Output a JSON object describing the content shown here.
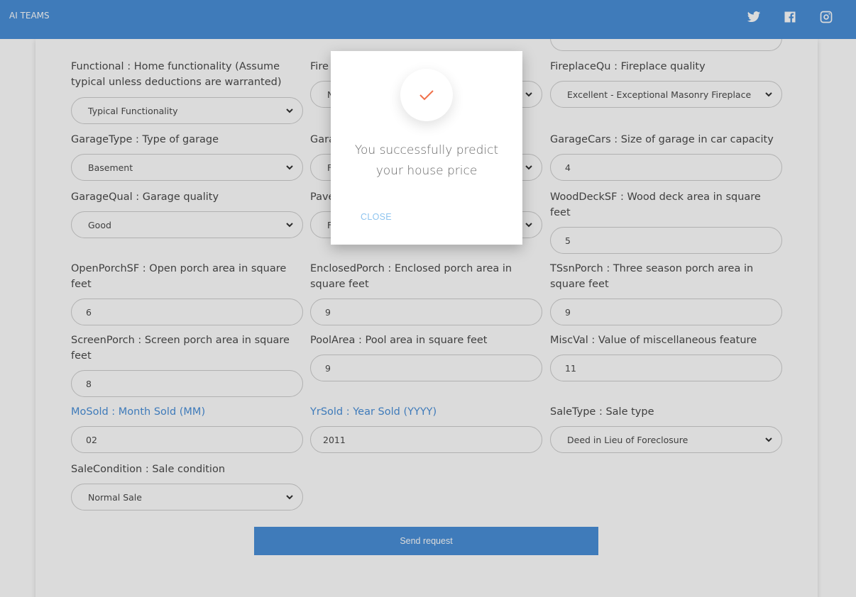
{
  "navbar": {
    "brand": "AI TEAMS",
    "icons": [
      "twitter-icon",
      "facebook-icon",
      "instagram-icon"
    ],
    "color": "#4a90d9"
  },
  "form": {
    "top_stub": "",
    "functional": {
      "label": "Functional : Home functionality (Assume typical unless deductions are warranted)",
      "value": "Typical Functionality"
    },
    "fireplaces": {
      "label": "Fire",
      "value": "N"
    },
    "fireplacequ": {
      "label": "FireplaceQu : Fireplace quality",
      "value": "Excellent - Exceptional Masonry Fireplace"
    },
    "garagetype": {
      "label": "GarageType : Type of garage",
      "value": "Basement"
    },
    "garagefinish": {
      "label": "Gara",
      "value": "F"
    },
    "garagecars": {
      "label": "GarageCars : Size of garage in car capacity",
      "value": "4"
    },
    "garagequal": {
      "label": "GarageQual : Garage quality",
      "value": "Good"
    },
    "paveddrive": {
      "label": "Pave",
      "value": "F"
    },
    "wooddecksf": {
      "label": "WoodDeckSF : Wood deck area in square feet",
      "value": "5"
    },
    "openporchsf": {
      "label": "OpenPorchSF : Open porch area in square feet",
      "value": "6"
    },
    "enclosedporch": {
      "label": "EnclosedPorch : Enclosed porch area in square feet",
      "value": "9"
    },
    "tssnporch": {
      "label": "TSsnPorch : Three season porch area in square feet",
      "value": "9"
    },
    "screenporch": {
      "label": "ScreenPorch : Screen porch area in square feet",
      "value": "8"
    },
    "poolarea": {
      "label": "PoolArea : Pool area in square feet",
      "value": "9"
    },
    "miscval": {
      "label": "MiscVal : Value of miscellaneous feature",
      "value": "11"
    },
    "mosold": {
      "label": "MoSold : Month Sold (MM)",
      "value": "02"
    },
    "yrsold": {
      "label": "YrSold : Year Sold (YYYY)",
      "value": "2011"
    },
    "saletype": {
      "label": "SaleType : Sale type",
      "value": "Deed in Lieu of Foreclosure"
    },
    "salecondition": {
      "label": "SaleCondition : Sale condition",
      "value": "Normal Sale"
    },
    "send_label": "Send request"
  },
  "modal": {
    "icon": "check-icon",
    "message": "You successfully predict your house price",
    "close_label": "CLOSE",
    "check_color": "#f0704a"
  }
}
